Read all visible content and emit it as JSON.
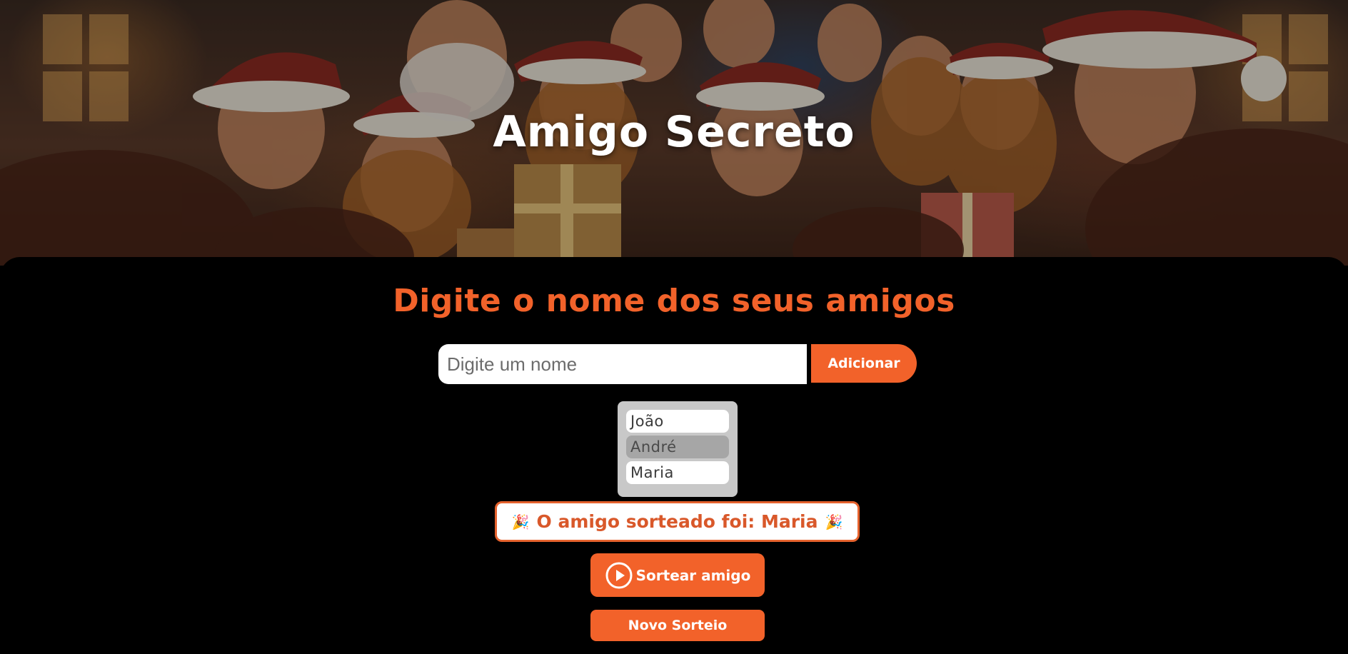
{
  "header": {
    "title": "Amigo Secreto",
    "banner_image": "christmas-party-friends-illustration"
  },
  "main": {
    "subtitle": "Digite o nome dos seus amigos",
    "name_input": {
      "value": "",
      "placeholder": "Digite um nome"
    },
    "add_button_label": "Adicionar",
    "friends": [
      "João",
      "André",
      "Maria"
    ],
    "highlighted_friend_index": 1,
    "result": {
      "prefix_icon": "🎉",
      "text": "O amigo sorteado foi: Maria",
      "suffix_icon": "🎉"
    },
    "draw_button": {
      "icon": "play-circle-icon",
      "label": "Sortear amigo"
    },
    "reset_button_label": "Novo Sorteio"
  },
  "colors": {
    "accent": "#f2622a",
    "result_text": "#d9582a",
    "background": "#000000",
    "list_background": "#c8c8c8"
  }
}
